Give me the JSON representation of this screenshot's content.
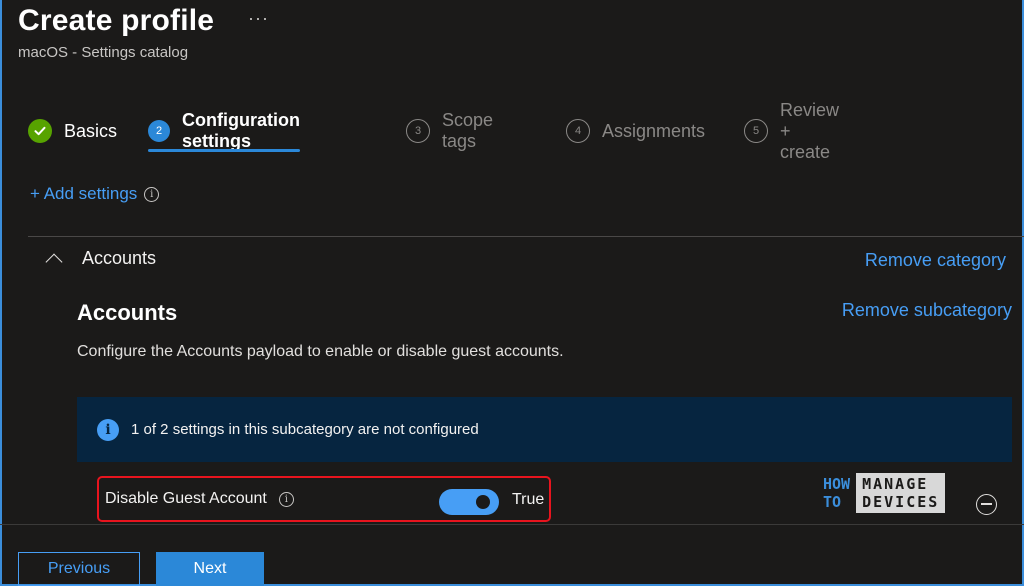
{
  "header": {
    "title": "Create profile",
    "more_label": "···",
    "subtitle": "macOS - Settings catalog"
  },
  "steps": [
    {
      "number": "✓",
      "label": "Basics",
      "state": "done"
    },
    {
      "number": "2",
      "label": "Configuration settings",
      "state": "active"
    },
    {
      "number": "3",
      "label": "Scope tags",
      "state": "pending"
    },
    {
      "number": "4",
      "label": "Assignments",
      "state": "pending"
    },
    {
      "number": "5",
      "label": "Review + create",
      "state": "pending"
    }
  ],
  "add_settings": {
    "label": "+ Add settings",
    "info": "i"
  },
  "category": {
    "name": "Accounts",
    "remove_label": "Remove category"
  },
  "subcategory": {
    "title": "Accounts",
    "remove_label": "Remove subcategory",
    "description": "Configure the Accounts payload to enable or disable guest accounts.",
    "info_icon": "i",
    "info_message": "1 of 2 settings in this subcategory are not configured"
  },
  "setting": {
    "label": "Disable Guest Account",
    "info": "i",
    "toggle_on": true,
    "value_label": "True"
  },
  "watermark": {
    "left_top": "HOW",
    "left_bottom": "TO",
    "right_top": "MANAGE",
    "right_bottom": "DEVICES"
  },
  "footer": {
    "previous_label": "Previous",
    "next_label": "Next"
  },
  "colors": {
    "background": "#1b1a19",
    "accent": "#2b88d8",
    "link": "#479ef5",
    "success": "#57a300",
    "highlight_border": "#e8141e"
  }
}
